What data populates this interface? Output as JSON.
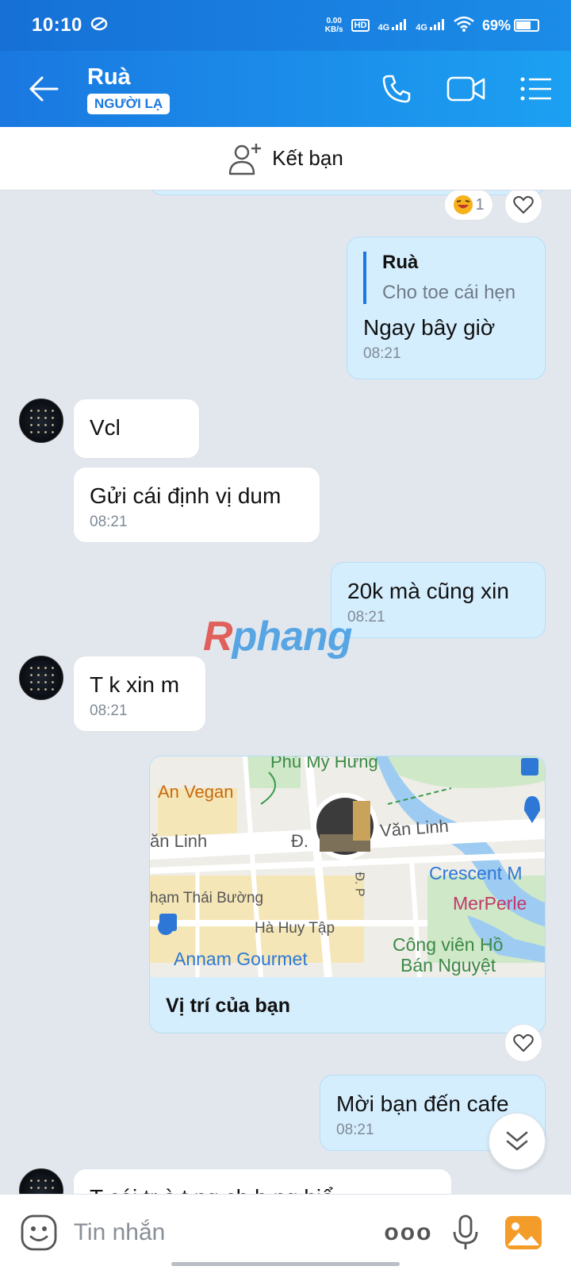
{
  "status_bar": {
    "time": "10:10",
    "net_speed_value": "0.00",
    "net_speed_unit": "KB/s",
    "hd": "HD",
    "signal1": "4G",
    "signal2": "4G",
    "battery_text": "69%",
    "battery_level": 0.69
  },
  "header": {
    "contact_name": "Ruà",
    "badge": "NGƯỜI LẠ"
  },
  "add_friend": {
    "label": "Kết bạn"
  },
  "messages": {
    "reaction_count": "1",
    "quote_reply": {
      "quoted_name": "Ruà",
      "quoted_text": "Cho toe cái hẹn",
      "text": "Ngay bây giờ",
      "time": "08:21"
    },
    "m_vcl": {
      "text": "Vcl"
    },
    "m_dinhvi": {
      "text": "Gửi cái định vị dum",
      "time": "08:21"
    },
    "m_20k": {
      "text": "20k mà cũng xin",
      "time": "08:21"
    },
    "m_tk": {
      "text": "T k xin m",
      "time": "08:21"
    },
    "location": {
      "caption": "Vị trí của bạn",
      "labels": {
        "phu_my_hung": "Phú Mỹ Hưng",
        "an_vegan": "An Vegan",
        "van_linh_left": "ăn Linh",
        "d_label": "Đ.",
        "van_linh_right": "Văn Linh",
        "pham_thai_buong": "hạm Thái Bường",
        "ha_huy_tap": "Hà Huy Tập",
        "crescent": "Crescent M",
        "merperle": "MerPerle",
        "cong_vien": "Công viên Hồ",
        "ban_nguyet": "Bán Nguyệt",
        "annam": "Annam Gourmet",
        "dp": "Đ. P"
      }
    },
    "m_moi": {
      "text": "Mời bạn đến cafe",
      "time": "08:21"
    },
    "m_partial": {
      "text": "T cái tr à t ng ch h ng hiể"
    }
  },
  "watermark": {
    "r": "R",
    "rest": "phang"
  },
  "input": {
    "placeholder": "Tin nhắn",
    "more_label": "ooo"
  },
  "colors": {
    "brand_blue": "#1a78e0",
    "outgoing_bubble": "#d5eefe",
    "chat_bg": "#e2e7ee"
  }
}
